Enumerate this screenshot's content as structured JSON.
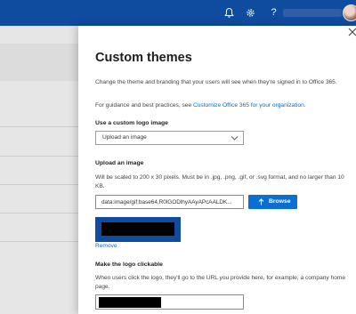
{
  "topbar": {
    "help_glyph": "?",
    "icons": [
      "bell-icon",
      "gear-icon",
      "help-icon",
      "avatar"
    ]
  },
  "panel": {
    "title": "Custom themes",
    "intro": "Change the theme and branding that your users will see when they're signed in to Office 365.",
    "guidance_prefix": "For guidance and best practices, see ",
    "guidance_link": "Customize Office 365 for your organization",
    "guidance_suffix": ".",
    "logo_section": {
      "label": "Use a custom logo image",
      "select_value": "Upload an image"
    },
    "upload_section": {
      "label": "Upload an image",
      "hint": "Will be scaled to 200 x 30 pixels. Must be in .jpg, .png, .gif, or .svg format, and no larger than 10 KB.",
      "file_value": "data:image/gif;base64,R0lGODlhyAAyAPcAALDK...",
      "browse_label": "Browse",
      "remove_label": "Remove"
    },
    "clickable_section": {
      "label": "Make the logo clickable",
      "hint": "When users click the logo, they'll go to the URL you provide here, for example, a company home page."
    }
  },
  "colors": {
    "nav": "#0f4b9e",
    "accent": "#0b6fcf",
    "link": "#0a6cc9"
  }
}
